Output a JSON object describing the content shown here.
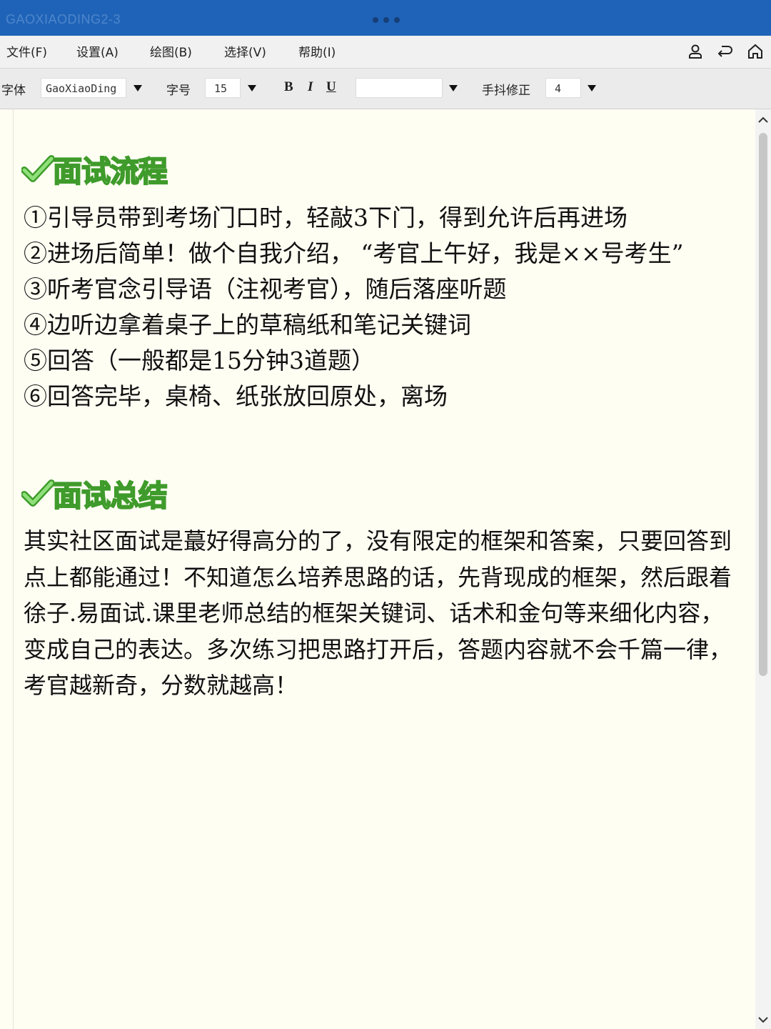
{
  "window": {
    "title": "GAOXIAODING2-3"
  },
  "menu": {
    "items": [
      "文件(F)",
      "设置(A)",
      "绘图(B)",
      "选择(V)",
      "帮助(I)"
    ],
    "icons": [
      "user-icon",
      "back-icon",
      "home-icon"
    ]
  },
  "toolbar": {
    "font_label": "字体",
    "font_value": "GaoXiaoDing",
    "size_label": "字号",
    "size_value": "15",
    "bold": "B",
    "italic": "I",
    "underline": "U",
    "style_value": "",
    "correction_label": "手抖修正",
    "correction_value": "4"
  },
  "colors": {
    "titlebar": "#1f63b8",
    "heading_fill": "#8fe07a",
    "heading_stroke": "#3f9b2b",
    "page": "#fffef3"
  },
  "document": {
    "section1": {
      "title": "面试流程",
      "items": [
        "①引导员带到考场门口时，轻敲3下门，得到允许后再进场",
        "②进场后简单！做个自我介绍，  “考官上午好，我是××号考生”",
        "③听考官念引导语（注视考官），随后落座听题",
        "④边听边拿着桌子上的草稿纸和笔记关键词",
        "⑤回答（一般都是15分钟3道题）",
        "⑥回答完毕，桌椅、纸张放回原处，离场"
      ]
    },
    "section2": {
      "title": "面试总结",
      "body": "其实社区面试是蕞好得高分的了，没有限定的框架和答案，只要回答到点上都能通过！不知道怎么培养思路的话，先背现成的框架，然后跟着徐子.易面试.课里老师总结的框架关键词、话术和金句等来细化内容，变成自己的表达。多次练习把思路打开后，答题内容就不会千篇一律，考官越新奇，分数就越高！"
    }
  }
}
